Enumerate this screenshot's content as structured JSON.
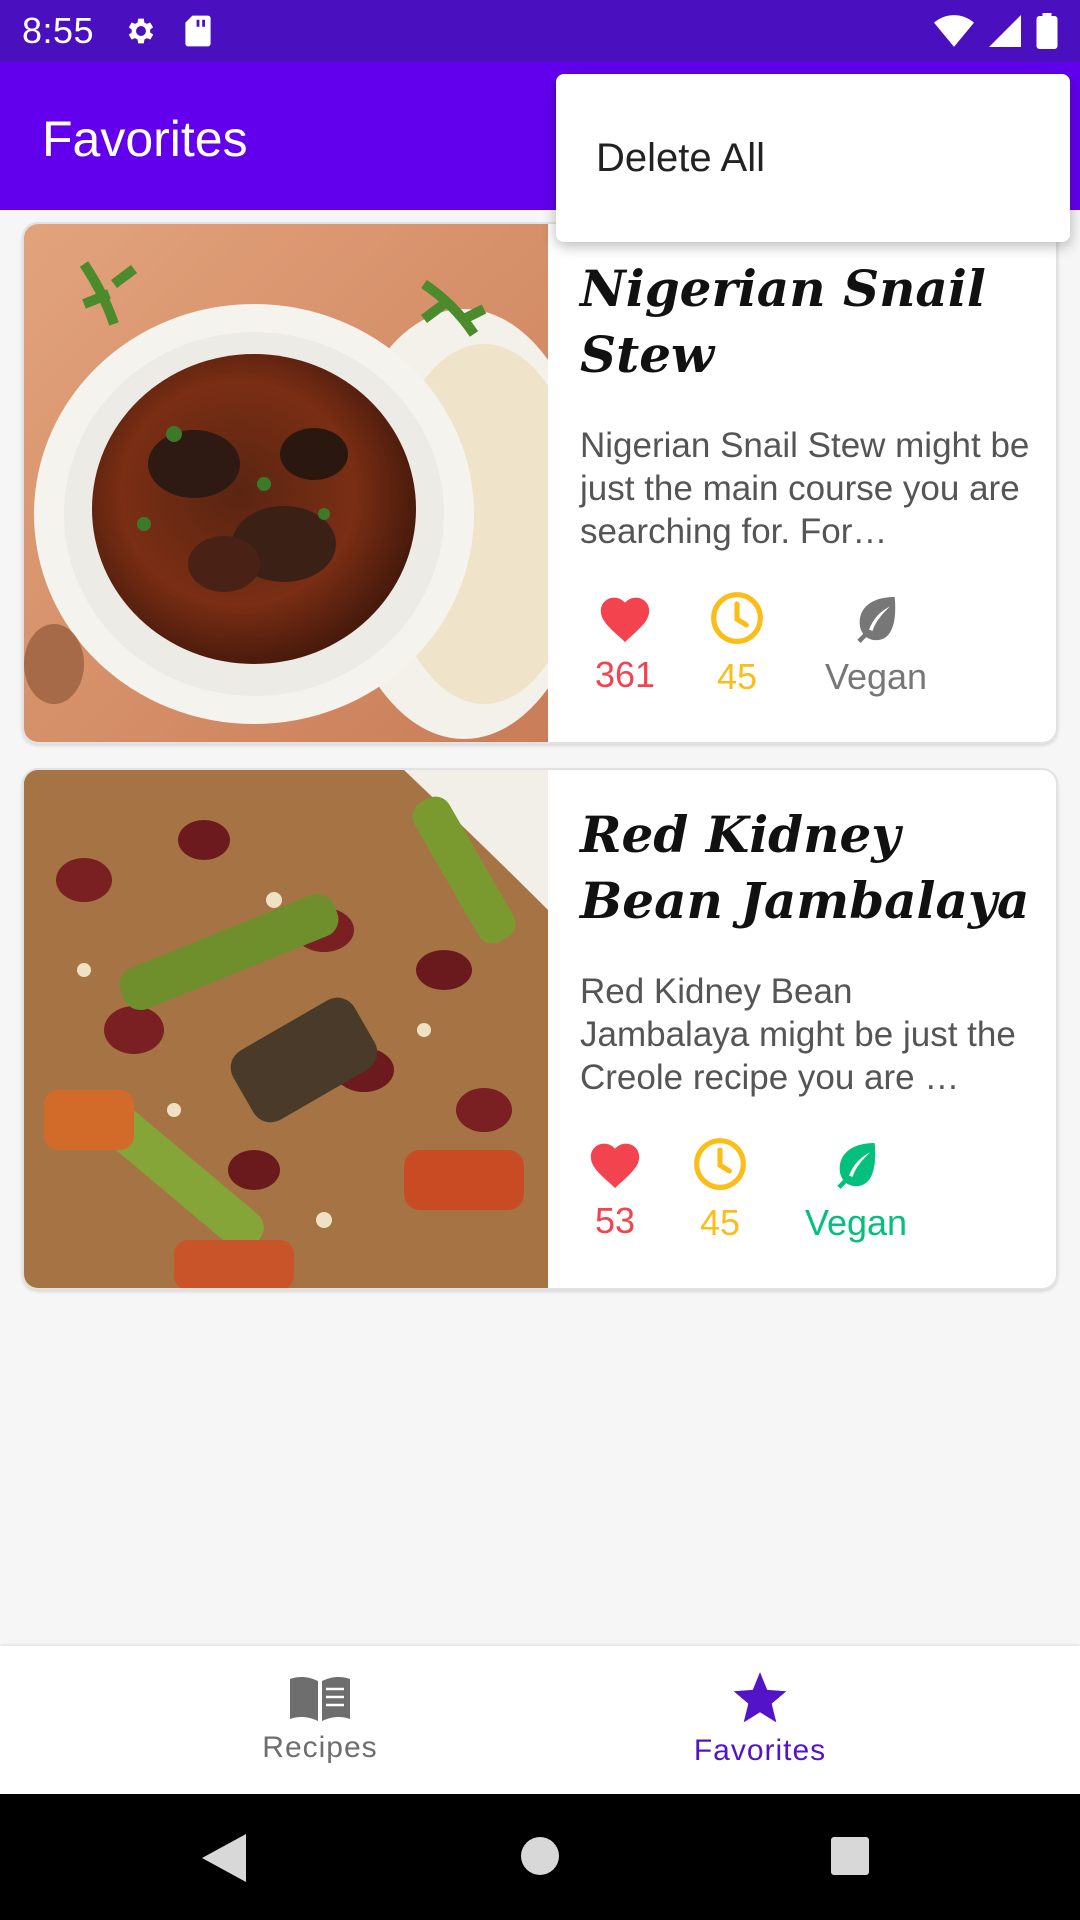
{
  "status_bar": {
    "time": "8:55",
    "left_icons": [
      "settings-icon",
      "sd-card-icon"
    ],
    "right_icons": [
      "wifi-icon",
      "signal-icon",
      "battery-icon"
    ]
  },
  "app_bar": {
    "title": "Favorites",
    "color": "#6200ee"
  },
  "overflow_menu": {
    "items": [
      {
        "label": "Delete All"
      }
    ]
  },
  "recipes": [
    {
      "title": "Nigerian Snail Stew",
      "description": "Nigerian Snail Stew might be just the main course you are searching for. For…",
      "likes": "361",
      "minutes": "45",
      "vegan_label": "Vegan",
      "vegan_active": false,
      "image": "snail-stew-photo"
    },
    {
      "title": "Red Kidney Bean Jambalaya",
      "description": "Red Kidney Bean Jambalaya might be just the Creole recipe you are …",
      "likes": "53",
      "minutes": "45",
      "vegan_label": "Vegan",
      "vegan_active": true,
      "image": "jambalaya-photo"
    }
  ],
  "colors": {
    "likes": "#f2434f",
    "time": "#fbbd19",
    "vegan_inactive": "#777777",
    "vegan_active": "#03c07c",
    "nav_selected": "#5314c7",
    "nav_unselected": "#6e6e6e"
  },
  "bottom_nav": {
    "items": [
      {
        "label": "Recipes",
        "icon": "book-icon",
        "selected": false
      },
      {
        "label": "Favorites",
        "icon": "star-icon",
        "selected": true
      }
    ]
  },
  "system_nav": {
    "buttons": [
      "back-icon",
      "home-icon",
      "recents-icon"
    ]
  }
}
